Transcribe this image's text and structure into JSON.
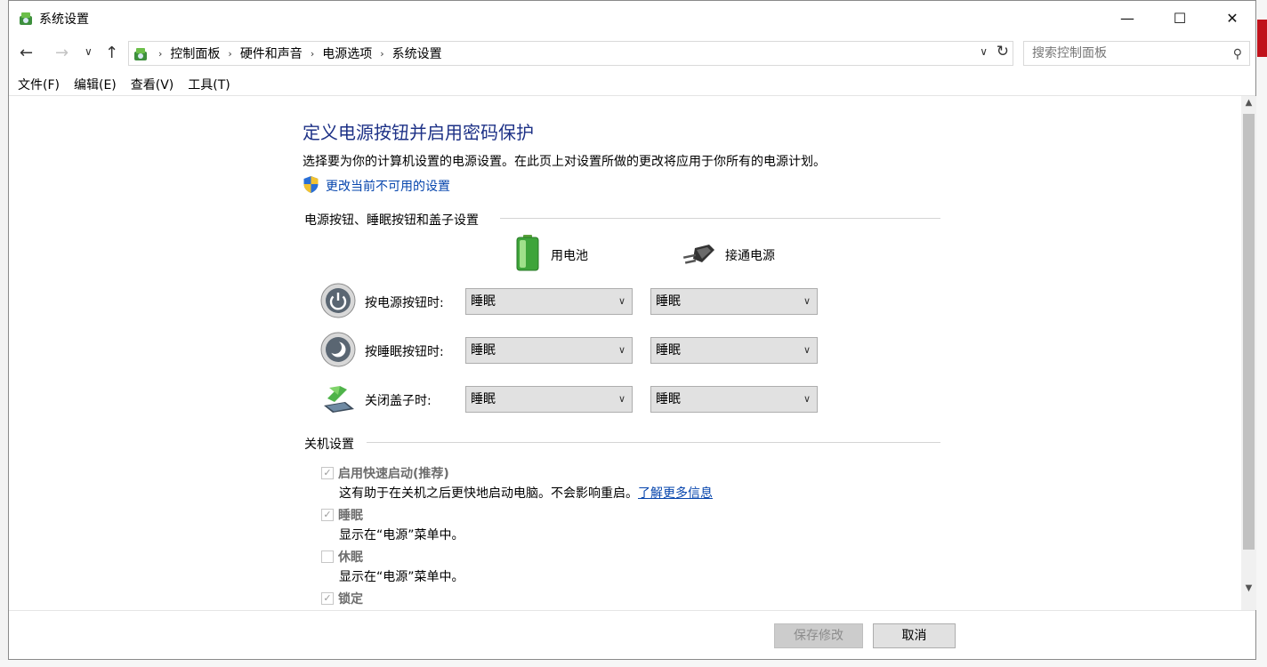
{
  "window": {
    "title": "系统设置",
    "controls": {
      "minimize": "—",
      "maximize": "☐",
      "close": "✕"
    }
  },
  "nav": {
    "back": "←",
    "forward": "→",
    "recent": "∨",
    "up": "↑",
    "breadcrumbs": [
      "控制面板",
      "硬件和声音",
      "电源选项",
      "系统设置"
    ],
    "crumb_separator": "›",
    "dropdown": "∨",
    "refresh": "↻",
    "search_placeholder": "搜索控制面板",
    "search_glyph": "⚲"
  },
  "menu": [
    "文件(F)",
    "编辑(E)",
    "查看(V)",
    "工具(T)"
  ],
  "page": {
    "title": "定义电源按钮并启用密码保护",
    "description": "选择要为你的计算机设置的电源设置。在此页上对设置所做的更改将应用于你所有的电源计划。",
    "change_link": "更改当前不可用的设置"
  },
  "power_section": {
    "heading": "电源按钮、睡眠按钮和盖子设置",
    "columns": [
      "用电池",
      "接通电源"
    ],
    "rows": [
      {
        "label": "按电源按钮时:",
        "battery": "睡眠",
        "plugged": "睡眠",
        "icon": "power-button-icon"
      },
      {
        "label": "按睡眠按钮时:",
        "battery": "睡眠",
        "plugged": "睡眠",
        "icon": "sleep-button-icon"
      },
      {
        "label": "关闭盖子时:",
        "battery": "睡眠",
        "plugged": "睡眠",
        "icon": "laptop-lid-icon"
      }
    ],
    "chevron": "∨"
  },
  "shutdown_section": {
    "heading": "关机设置",
    "items": [
      {
        "label": "启用快速启动(推荐)",
        "checked": true,
        "desc": "这有助于在关机之后更快地启动电脑。不会影响重启。",
        "link": "了解更多信息"
      },
      {
        "label": "睡眠",
        "checked": true,
        "desc": "显示在“电源”菜单中。"
      },
      {
        "label": "休眠",
        "checked": false,
        "desc": "显示在“电源”菜单中。"
      },
      {
        "label": "锁定",
        "checked": true
      }
    ],
    "check_glyph": "✓"
  },
  "scrollbar": {
    "up": "▲",
    "down": "▼"
  },
  "footer": {
    "save": "保存修改",
    "cancel": "取消"
  },
  "colors": {
    "title_blue": "#1e3287",
    "link_blue": "#0645ad"
  }
}
